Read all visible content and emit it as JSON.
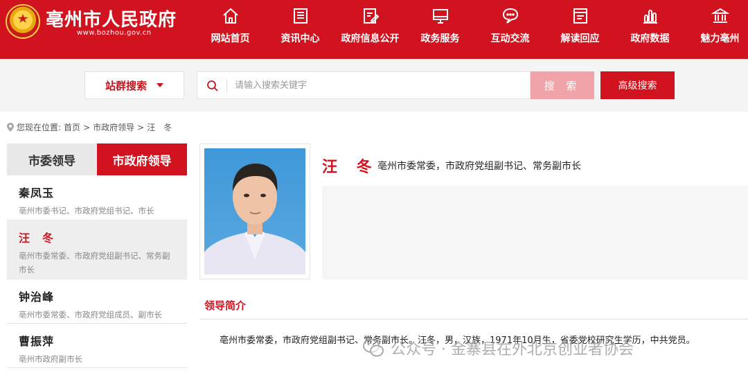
{
  "header": {
    "site_title": "亳州市人民政府",
    "site_url": "www.bozhou.gov.cn",
    "nav": [
      {
        "label": "网站首页",
        "icon": "home-icon"
      },
      {
        "label": "资讯中心",
        "icon": "news-icon"
      },
      {
        "label": "政府信息公开",
        "icon": "document-edit-icon"
      },
      {
        "label": "政务服务",
        "icon": "monitor-icon"
      },
      {
        "label": "互动交流",
        "icon": "chat-icon"
      },
      {
        "label": "解读回应",
        "icon": "book-icon"
      },
      {
        "label": "政府数据",
        "icon": "bar-chart-icon"
      },
      {
        "label": "魅力亳州",
        "icon": "building-icon"
      }
    ]
  },
  "search": {
    "site_select": "站群搜索",
    "placeholder": "请输入搜索关键字",
    "search_button": "搜 索",
    "advanced_button": "高级搜索"
  },
  "breadcrumb": {
    "prefix": "您现在位置:",
    "items": [
      "首页",
      ">",
      "市政府领导",
      ">",
      "汪　冬"
    ]
  },
  "tabs": [
    "市委领导",
    "市政府领导"
  ],
  "leaders": [
    {
      "name": "秦凤玉",
      "role": "亳州市委书记、市政府党组书记、市长"
    },
    {
      "name": "汪　冬",
      "role": "亳州市委常委、市政府党组副书记、常务副市长"
    },
    {
      "name": "钟治峰",
      "role": "亳州市委常委、市政府党组成员、副市长"
    },
    {
      "name": "曹振萍",
      "role": "亳州市政府副市长"
    }
  ],
  "profile": {
    "name": "汪 冬",
    "title": "亳州市委常委，市政府党组副书记、常务副市长",
    "section_title": "领导简介",
    "bio": "亳州市委常委，市政府党组副书记、常务副市长。汪冬，男，汉族，1971年10月生，省委党校研究生学历，中共党员。"
  },
  "watermark": {
    "text": "公众号 · 金寨县在外北京创业者协会"
  },
  "colors": {
    "brand_red": "#d0131f",
    "search_button_pink": "#f0a3a8"
  }
}
